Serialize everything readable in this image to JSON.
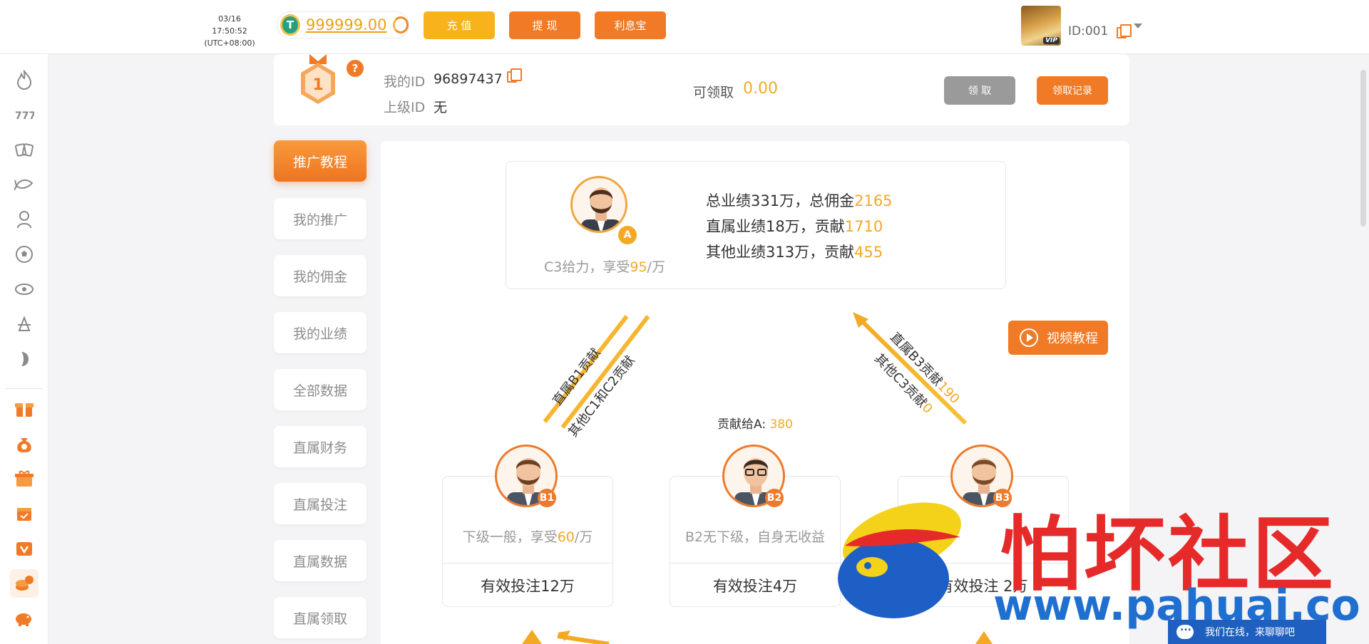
{
  "header": {
    "datetime": "03/16 17:50:52",
    "timezone": "(UTC+08:00)",
    "balance": "999999.00",
    "coin_symbol": "T",
    "btn_recharge": "充 值",
    "btn_withdraw": "提 现",
    "btn_interest": "利息宝",
    "vip_badge": "VIP",
    "user_id": "ID:001"
  },
  "sidebar": {
    "icons": [
      "fire-icon",
      "slots-777-icon",
      "cards-icon",
      "fish-icon",
      "dealer-icon",
      "soccer-ball-icon",
      "lottery-icon",
      "rooster-icon",
      "cockfight-icon",
      "gift-box-icon",
      "money-bag-icon",
      "present-icon",
      "calendar-icon",
      "vip-shield-icon",
      "coins-icon",
      "piggy-bank-icon"
    ]
  },
  "info": {
    "my_id_label": "我的ID",
    "my_id": "96897437",
    "parent_id_label": "上级ID",
    "parent_id": "无",
    "claimable_label": "可领取",
    "claimable_value": "0.00",
    "btn_claim": "领 取",
    "btn_claim_record": "领取记录",
    "medal_rank": "1",
    "help_mark": "?"
  },
  "menu": {
    "items": [
      "推广教程",
      "我的推广",
      "我的佣金",
      "我的业绩",
      "全部数据",
      "直属财务",
      "直属投注",
      "直属数据",
      "直属领取"
    ]
  },
  "tutorial": {
    "a_tag": "A",
    "a_caption_pre": "C3给力，享受",
    "a_caption_val": "95",
    "a_caption_post": "/万",
    "stat1_pre": "总业绩331万，总佣金",
    "stat1_val": "2165",
    "stat2_pre": "直属业绩18万，贡献",
    "stat2_val": "1710",
    "stat3_pre": "其他业绩313万，贡献",
    "stat3_val": "455",
    "video_btn": "视频教程",
    "arrow_left_top": "直属B1贡献",
    "arrow_left_bottom": "其他C1和C2贡献",
    "arrow_right_top_pre": "直属B3贡献",
    "arrow_right_top_val": "190",
    "arrow_right_bottom_pre": "其他C3贡献",
    "arrow_right_bottom_val": "0",
    "contrib_label": "贡献给A: ",
    "contrib_val": "380",
    "b1_tag": "B1",
    "b1_caption_pre": "下级一般，享受",
    "b1_caption_val": "60",
    "b1_caption_post": "/万",
    "b1_bet": "有效投注12万",
    "b2_tag": "B2",
    "b2_caption": "B2无下级，自身无收益",
    "b2_bet": "有效投注4万",
    "b3_tag": "B3",
    "b3_bet": "有效投注 2万"
  },
  "watermark": {
    "text": "怕坏社区",
    "url": "www.pahuai.com"
  },
  "chat": {
    "label": "我们在线，来聊聊吧"
  },
  "colors": {
    "accent": "#f07a25",
    "highlight": "#f4a925",
    "yellow_button": "#f7b21c",
    "gray_button": "#9a9a9a"
  }
}
